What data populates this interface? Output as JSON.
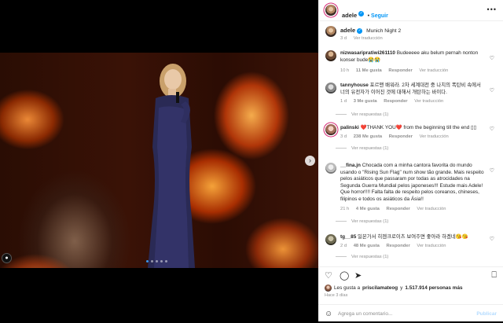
{
  "post": {
    "username": "adele",
    "follow_label": "Seguir",
    "more_label": "•••",
    "caption": "Munich Night 2",
    "caption_age": "3 d",
    "caption_translate": "Ver traducción"
  },
  "carousel": {
    "next_glyph": "›",
    "tag_glyph": "👤",
    "dot_count": 5,
    "active_index": 0
  },
  "comments": [
    {
      "user": "nizwasaripratiwi261110",
      "text": "Budeeeee aku belum pernah nonton konser bude😭😭",
      "age": "10 h",
      "likes": "11 Me gusta",
      "reply": "Responder",
      "translate": "Ver traducción",
      "replies": ""
    },
    {
      "user": "tannyhouse",
      "text": "포르맨 배워라. 2차 세계대전 중 나치의 폭탄비 속에서 너의 유전자가 이어진 것에 대해서 개탄하는 바이다.",
      "age": "1 d",
      "likes": "3 Me gusta",
      "reply": "Responder",
      "translate": "Ver traducción",
      "replies": "Ver respuestas (1)"
    },
    {
      "user": "palinski",
      "text": "❤️THANK YOU❤️ from the beginning till the end ▯▯",
      "age": "3 d",
      "likes": "238 Me gusta",
      "reply": "Responder",
      "translate": "Ver traducción",
      "replies": "Ver respuestas (1)"
    },
    {
      "user": "__fina.jn",
      "text": "Chocada com a minha cantora favorita do mundo usando o \"Rising Sun Flag\" num show tão grande. Mais respeito pelos asiáticos que passaram por todas as atrocidades na Segunda Guerra Mundial pelos japoneses!!! Estude mais Adele! Que horror!!!! Falta falta de respeito pelos coreanos, chineses, filipinos e todos os asiáticos da Ásia!!",
      "age": "21 h",
      "likes": "4 Me gusta",
      "reply": "Responder",
      "translate": "Ver traducción",
      "replies": "Ver respuestas (1)"
    },
    {
      "user": "tg__85",
      "text": "일본가서 히첸크로이츠 보여주면 좋아라 하겠네😘😘",
      "age": "2 d",
      "likes": "48 Me gusta",
      "reply": "Responder",
      "translate": "Ver traducción",
      "replies": "Ver respuestas (1)"
    }
  ],
  "likes": {
    "prefix": "Les gusta a",
    "user": "priscilamateog",
    "middle": "y",
    "count": "1.517.914 personas más"
  },
  "posted_ago": "Hace 3 días",
  "comment_box": {
    "placeholder": "Agrega un comentario...",
    "publish": "Publicar"
  },
  "icons": {
    "heart": "♡",
    "comment": "◯",
    "share": "➤",
    "save": "⎕",
    "emoji": "☺"
  }
}
